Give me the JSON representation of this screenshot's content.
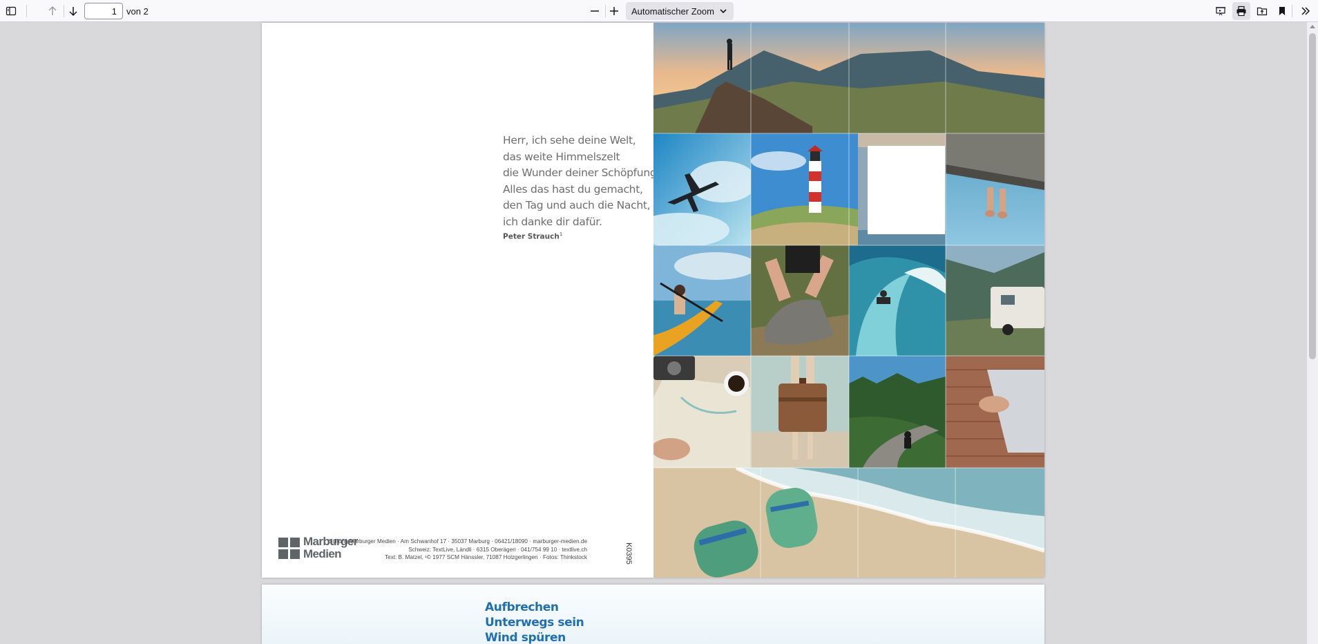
{
  "toolbar": {
    "page_number": "1",
    "page_count_label": "von 2",
    "zoom_label": "Automatischer Zoom",
    "icons": {
      "sidebar": "sidebar-toggle-icon",
      "prev": "arrow-up-icon",
      "next": "arrow-down-icon",
      "zoom_out": "minus-icon",
      "zoom_in": "plus-icon",
      "presentation": "presentation-icon",
      "print": "print-icon",
      "open": "open-folder-icon",
      "bookmark": "bookmark-icon",
      "more": "double-chevron-icon"
    }
  },
  "page1": {
    "poem_lines": [
      "Herr, ich sehe deine Welt,",
      "das weite Himmelszelt",
      "die Wunder deiner Schöpfung.",
      "Alles das hast du gemacht,",
      "den Tag und auch die Nacht,",
      "ich danke dir dafür."
    ],
    "author": "Peter Strauch",
    "author_note": "1",
    "logo_line1": "Marburger",
    "logo_line2": "Medien",
    "imprint_lines": [
      "Stiftung Marburger Medien · Am Schwanhof 17 · 35037 Marburg · 06421/18090 · marburger-medien.de",
      "Schweiz: TextLive, Ländli · 6315 Oberägeri · 041/754 99 10 · textlive.ch",
      "Text: B. Matzel, ¹© 1977 SCM Hänssler, 71087 Holzgerlingen · Fotos: Thinkstock"
    ],
    "code": "K0395",
    "photos": [
      "mountain-hiker",
      "airplane-sky",
      "lighthouse-dunes",
      "blank-square",
      "feet-over-water",
      "kayak",
      "hiking-boot-laces",
      "surfer-wave",
      "camper-van",
      "map-camera-coffee",
      "suitcase-legs",
      "motorcycle-road",
      "person-on-deck",
      "flip-flops-beach"
    ]
  },
  "page2": {
    "lines": [
      "Aufbrechen",
      "Unterwegs sein",
      "Wind spüren"
    ]
  },
  "colors": {
    "toolbar_bg": "#f9f9fb",
    "viewer_bg": "#d9d9dc",
    "poem_text": "#6e6e6e",
    "page2_heading": "#1f6fb2"
  }
}
